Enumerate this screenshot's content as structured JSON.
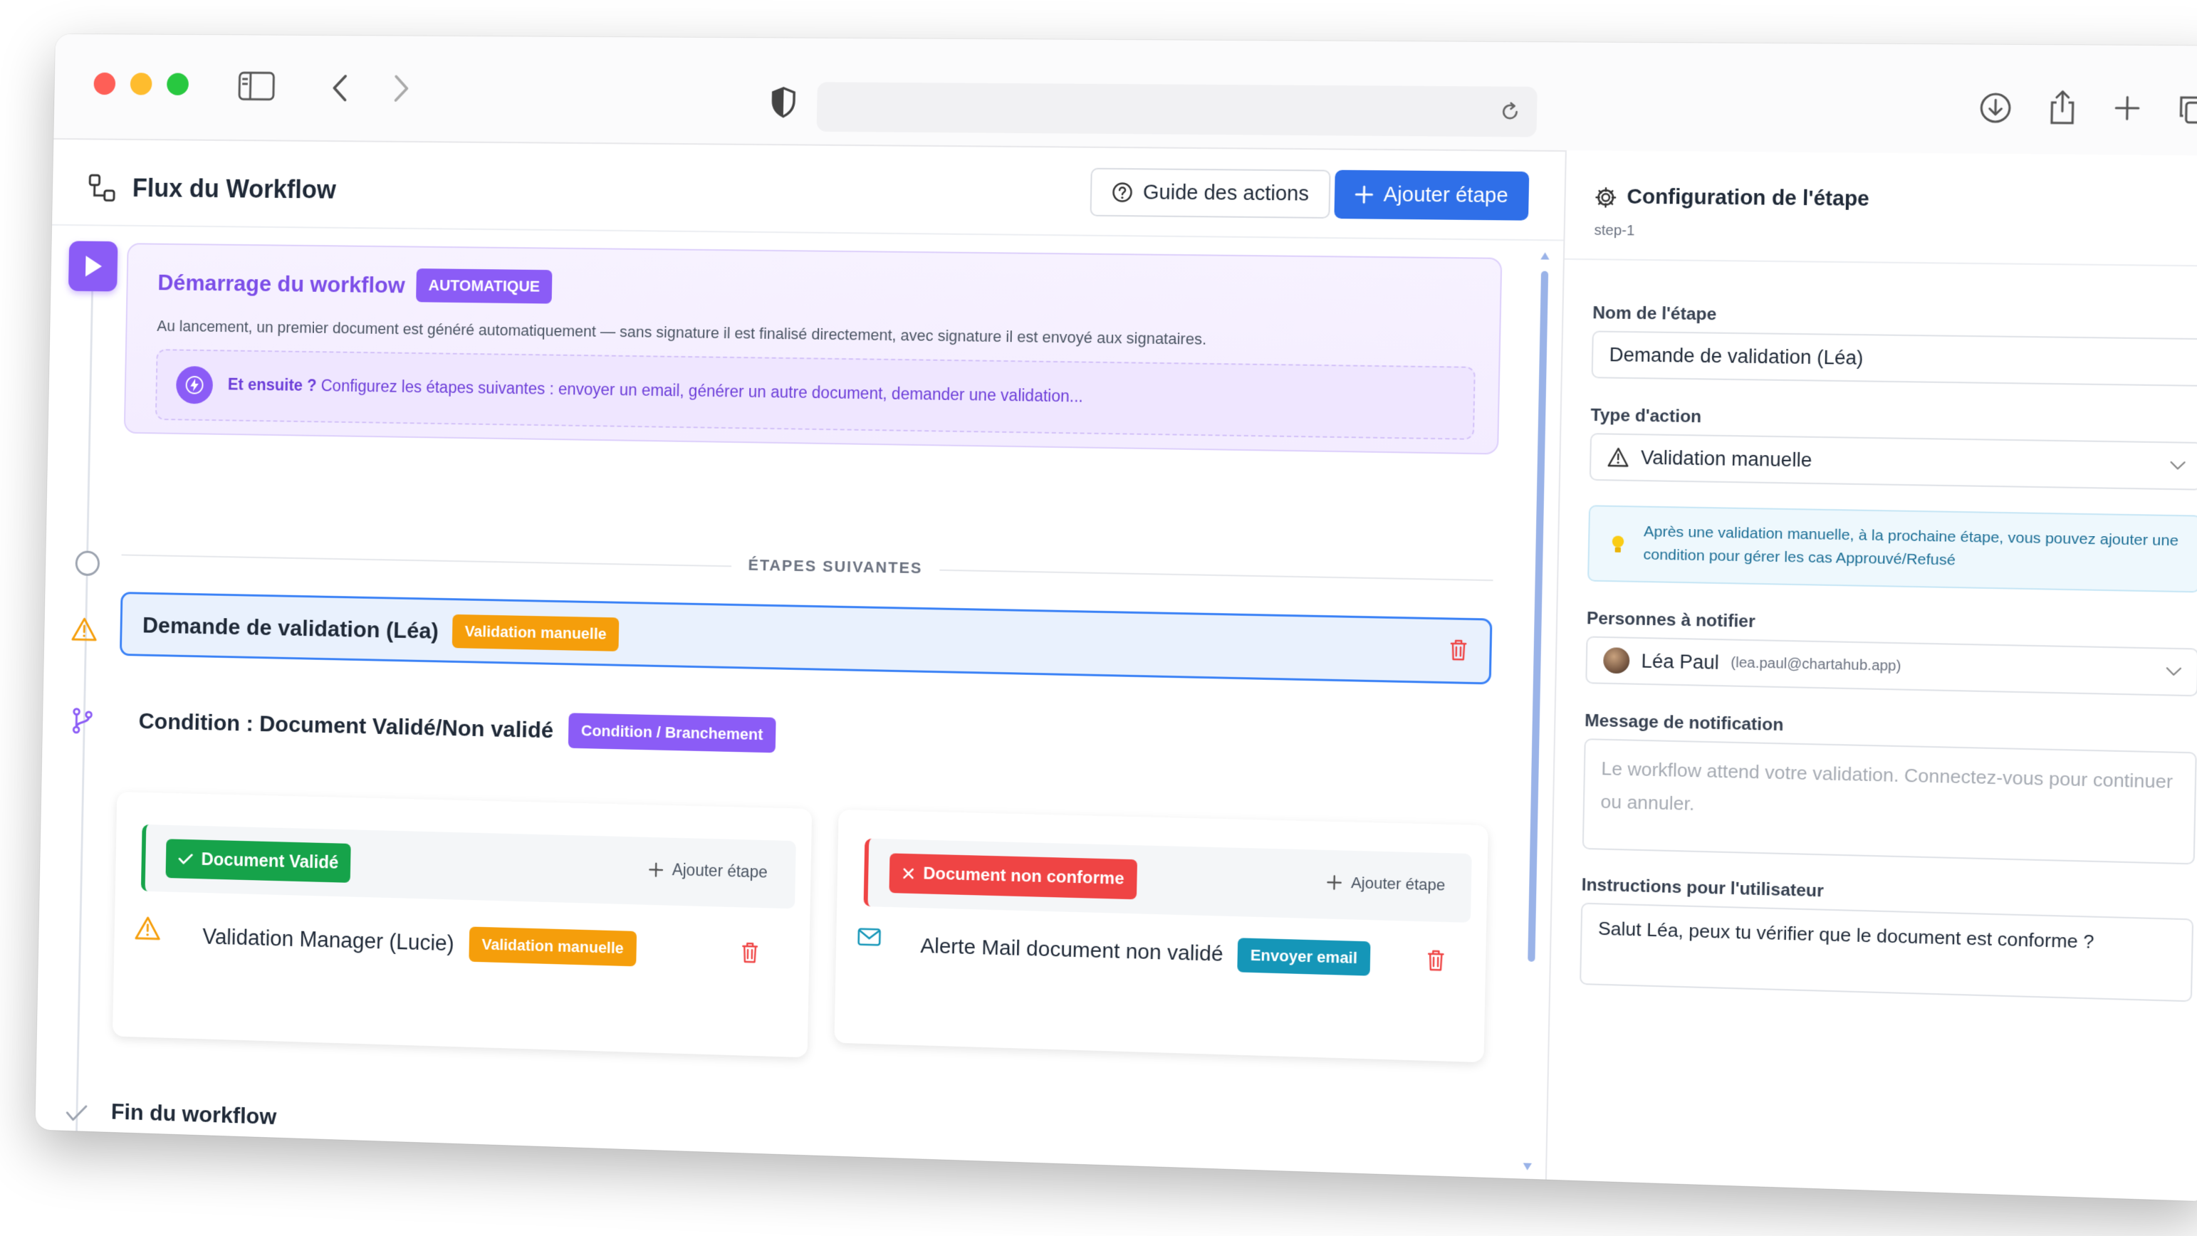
{
  "workflow": {
    "title": "Flux du Workflow",
    "guide_button": "Guide des actions",
    "add_step_button": "Ajouter étape",
    "start": {
      "title": "Démarrage du workflow",
      "badge": "AUTOMATIQUE",
      "description": "Au lancement, un premier document est généré automatiquement — sans signature il est finalisé directement, avec signature il est envoyé aux signataires.",
      "hint_bold": "Et ensuite ?",
      "hint_text": "Configurez les étapes suivantes : envoyer un email, générer un autre document, demander une validation..."
    },
    "divider_label": "ÉTAPES SUIVANTES",
    "step1": {
      "title": "Demande de validation (Léa)",
      "badge": "Validation manuelle"
    },
    "condition": {
      "title": "Condition : Document Validé/Non validé",
      "badge": "Condition / Branchement"
    },
    "branch_ok": {
      "label": "Document Validé",
      "add": "Ajouter étape",
      "step_title": "Validation Manager (Lucie)",
      "step_badge": "Validation manuelle"
    },
    "branch_ko": {
      "label": "Document non conforme",
      "add": "Ajouter étape",
      "step_title": "Alerte Mail document non validé",
      "step_badge": "Envoyer email"
    },
    "end": "Fin du workflow"
  },
  "config": {
    "title": "Configuration de l'étape",
    "step_id": "step-1",
    "name_label": "Nom de l'étape",
    "name_value": "Demande de validation (Léa)",
    "type_label": "Type d'action",
    "type_value": "Validation manuelle",
    "tip": "Après une validation manuelle, à la prochaine étape, vous pouvez ajouter une condition pour gérer les cas Approuvé/Refusé",
    "notify_label": "Personnes à notifier",
    "notify_name": "Léa Paul",
    "notify_email": "(lea.paul@chartahub.app)",
    "message_label": "Message de notification",
    "message_placeholder": "Le workflow attend votre validation. Connectez-vous pour continuer ou annuler.",
    "instructions_label": "Instructions pour l'utilisateur",
    "instructions_value": "Salut Léa, peux tu vérifier que le document est conforme ?"
  },
  "colors": {
    "primary": "#2f6fe8",
    "purple": "#8b5cf6",
    "orange": "#f59e0b",
    "green": "#16a34a",
    "red": "#ef4444",
    "teal": "#1596b8"
  }
}
